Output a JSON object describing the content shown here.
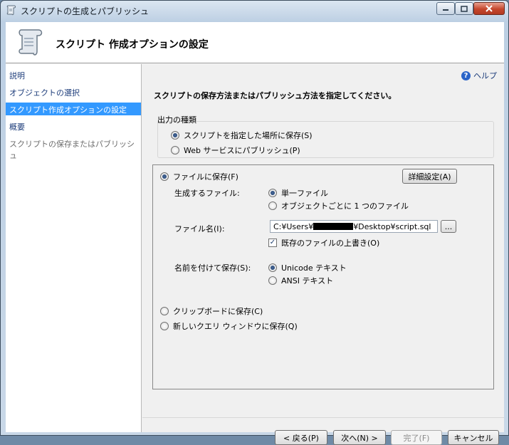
{
  "window": {
    "title": "スクリプトの生成とパブリッシュ"
  },
  "header": {
    "title": "スクリプト 作成オプションの設定"
  },
  "nav": {
    "items": [
      {
        "label": "説明"
      },
      {
        "label": "オブジェクトの選択"
      },
      {
        "label": "スクリプト作成オプションの設定"
      },
      {
        "label": "概要"
      },
      {
        "label": "スクリプトの保存またはパブリッシュ"
      }
    ],
    "selected_index": 2
  },
  "help": {
    "label": "ヘルプ"
  },
  "instruction": "スクリプトの保存方法またはパブリッシュ方法を指定してください。",
  "output_type": {
    "label": "出力の種類",
    "option_save": "スクリプトを指定した場所に保存(S)",
    "option_web": "Web サービスにパブリッシュ(P)",
    "selected": "option_save"
  },
  "save": {
    "save_to_file": "ファイルに保存(F)",
    "advanced_button": "詳細設定(A)",
    "files_to_generate_label": "生成するファイル:",
    "single_file": "単一ファイル",
    "per_object": "オブジェクトごとに 1 つのファイル",
    "file_name_label": "ファイル名(I):",
    "file_name_prefix": "C:¥Users¥",
    "file_name_suffix": "¥Desktop¥script.sql",
    "browse_button": "...",
    "overwrite_label": "既存のファイルの上書き(O)",
    "overwrite_checked": true,
    "save_as_label": "名前を付けて保存(S):",
    "unicode_text": "Unicode テキスト",
    "ansi_text": "ANSI テキスト",
    "clipboard": "クリップボードに保存(C)",
    "new_query_window": "新しいクエリ ウィンドウに保存(Q)"
  },
  "buttons": {
    "back": "< 戻る(P)",
    "next": "次へ(N) >",
    "finish": "完了(F)",
    "cancel": "キャンセル"
  },
  "icons": {
    "title": "script-scroll-icon",
    "header": "script-scroll-icon",
    "help": "help-icon"
  }
}
